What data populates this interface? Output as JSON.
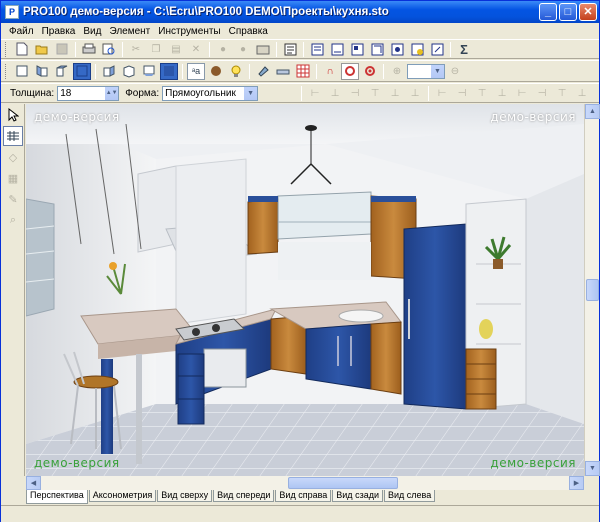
{
  "window": {
    "title": "PRO100 демо-версия - C:\\Ecru\\PRO100 DEMO\\Проекты\\кухня.sto",
    "app_icon": "P",
    "minimize_label": "_",
    "maximize_label": "□",
    "close_label": "✕"
  },
  "menu": {
    "items": [
      "Файл",
      "Правка",
      "Вид",
      "Элемент",
      "Инструменты",
      "Справка"
    ]
  },
  "toolbar3": {
    "thickness_label": "Толщина:",
    "thickness_value": "18",
    "shape_label": "Форма:",
    "shape_value": "Прямоугольник"
  },
  "viewport": {
    "watermark_top_left": "демо-версия",
    "watermark_top_right": "демо-версия",
    "watermark_bottom_left": "демо-версия",
    "watermark_bottom_right": "демо-версия"
  },
  "tabs": {
    "items": [
      "Перспектива",
      "Аксонометрия",
      "Вид сверху",
      "Вид спереди",
      "Вид справа",
      "Вид сзади",
      "Вид слева"
    ],
    "active_index": 0
  },
  "colors": {
    "title_bar": "#0454e3",
    "cabinet_blue": "#2a4f9a",
    "wood": "#b5762e",
    "countertop": "#d8c9c0"
  }
}
